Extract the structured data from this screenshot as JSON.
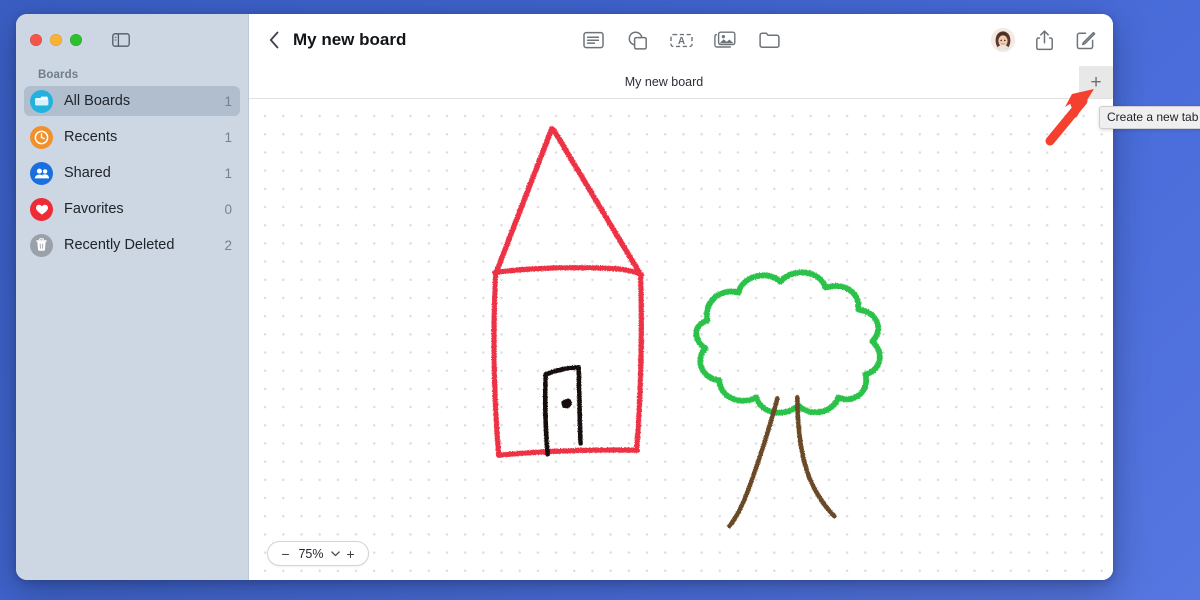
{
  "window": {
    "traffic_lights": [
      {
        "name": "close",
        "color": "#f3554a"
      },
      {
        "name": "minimize",
        "color": "#f8b133"
      },
      {
        "name": "zoom",
        "color": "#2ac030"
      }
    ],
    "sidebar_toggle_icon": "sidebar-toggle-icon"
  },
  "sidebar": {
    "section_label": "Boards",
    "items": [
      {
        "label": "All Boards",
        "count": "1",
        "icon": "boards-icon",
        "selected": true
      },
      {
        "label": "Recents",
        "count": "1",
        "icon": "clock-icon",
        "selected": false
      },
      {
        "label": "Shared",
        "count": "1",
        "icon": "people-icon",
        "selected": false
      },
      {
        "label": "Favorites",
        "count": "0",
        "icon": "heart-icon",
        "selected": false
      },
      {
        "label": "Recently Deleted",
        "count": "2",
        "icon": "trash-icon",
        "selected": false
      }
    ]
  },
  "toolbar": {
    "back_icon": "chevron-left-icon",
    "title": "My new board",
    "tools": [
      {
        "name": "sticky-note-icon",
        "label": "Sticky Note"
      },
      {
        "name": "shapes-icon",
        "label": "Shapes"
      },
      {
        "name": "text-box-icon",
        "label": "Text Box"
      },
      {
        "name": "media-icon",
        "label": "Media"
      },
      {
        "name": "files-icon",
        "label": "Files"
      }
    ],
    "avatar": "user-avatar",
    "share_icon": "share-icon",
    "compose_icon": "compose-icon"
  },
  "tabbar": {
    "active_tab_label": "My new board",
    "new_tab_label": "+",
    "new_tab_icon": "plus-icon"
  },
  "zoom_control": {
    "minus_label": "−",
    "value": "75%",
    "plus_label": "+",
    "chevron_icon": "chevron-down-icon"
  },
  "tooltip": {
    "text": "Create a new tab"
  },
  "annotation": {
    "arrow_color": "#f4402f",
    "arrow_name": "red-pointer-arrow"
  },
  "canvas": {
    "drawing_title": "house-and-tree-sketch",
    "colors": {
      "house": "#ee3345",
      "door": "#14110f",
      "tree_canopy": "#2cc24a",
      "tree_trunk": "#6b4a26",
      "grid_dot": "#dedede"
    },
    "objects": [
      {
        "name": "house-roof",
        "color": "#ee3345"
      },
      {
        "name": "house-body",
        "color": "#ee3345"
      },
      {
        "name": "house-door",
        "color": "#14110f"
      },
      {
        "name": "door-knob",
        "color": "#14110f"
      },
      {
        "name": "tree-canopy",
        "color": "#2cc24a"
      },
      {
        "name": "tree-trunk",
        "color": "#6b4a26"
      }
    ]
  }
}
